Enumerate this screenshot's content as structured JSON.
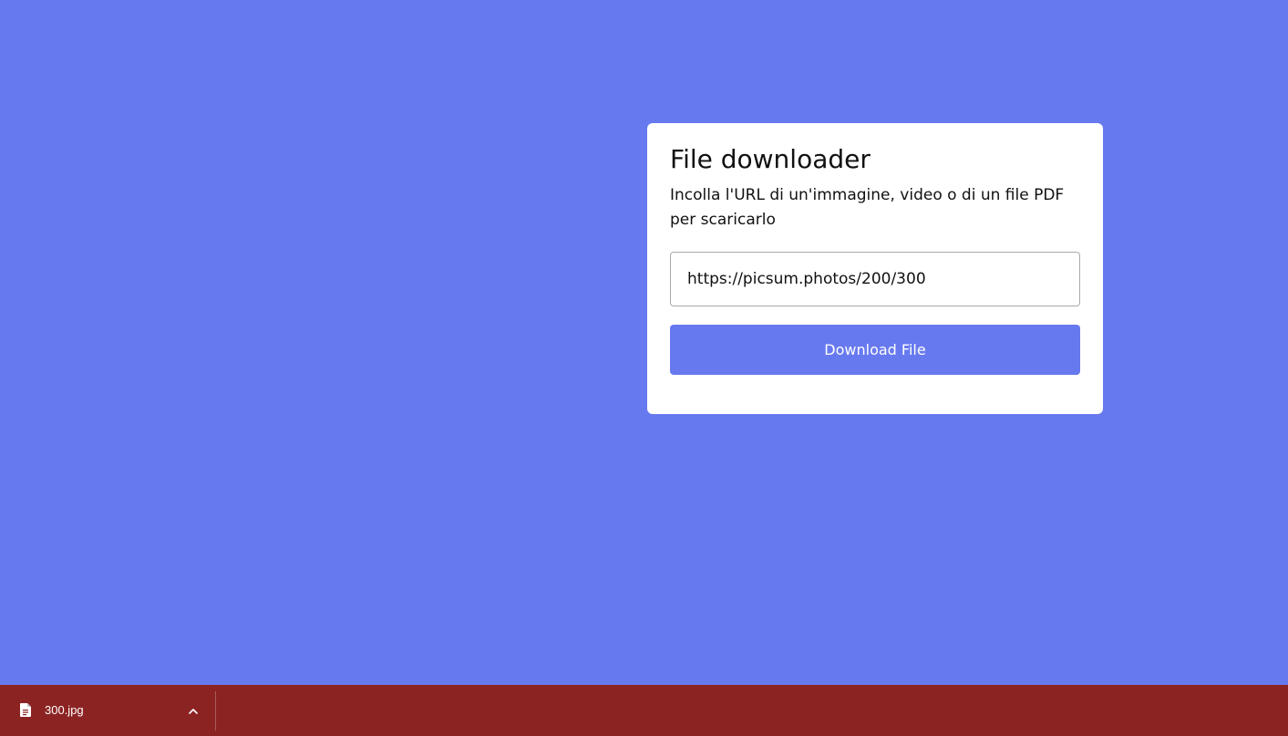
{
  "colors": {
    "background": "#6779ef",
    "card": "#ffffff",
    "button": "#6779ef",
    "download_bar": "#8c2323"
  },
  "card": {
    "title": "File downloader",
    "description": "Incolla l'URL di un'immagine, video o di un file PDF per scaricarlo",
    "url_input_value": "https://picsum.photos/200/300",
    "button_label": "Download File"
  },
  "download_bar": {
    "file_icon": "document-icon",
    "file_name": "300.jpg",
    "expand_icon": "chevron-up-icon"
  }
}
